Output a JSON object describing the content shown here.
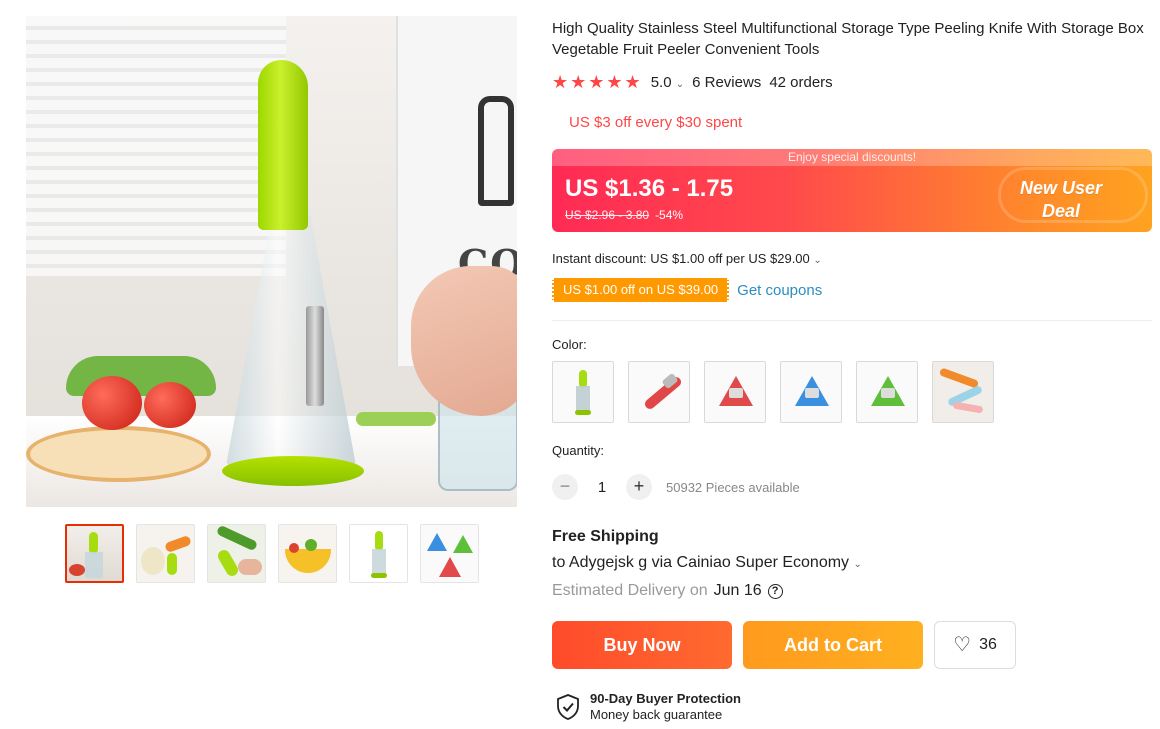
{
  "product": {
    "title": "High Quality Stainless Steel Multifunctional Storage Type Peeling Knife With Storage Box Vegetable Fruit Peeler Convenient Tools",
    "rating": {
      "stars": "★★★★★",
      "value": "5.0",
      "reviews": "6 Reviews",
      "orders": "42 orders"
    },
    "store_promo": "US $3 off every $30 spent"
  },
  "price_banner": {
    "top_text": "Enjoy special discounts!",
    "price": "US $1.36 - 1.75",
    "old_price": "US $2.96 - 3.80",
    "discount": "-54%",
    "deal_line1": "New User",
    "deal_line2": "Deal"
  },
  "discounts": {
    "instant": "Instant discount: US $1.00 off per US $29.00",
    "coupon": "US $1.00 off on US $39.00",
    "get_coupons": "Get coupons"
  },
  "options": {
    "color_label": "Color:",
    "swatches": [
      "green-peeler",
      "red-peeler",
      "red-triangle",
      "blue-triangle",
      "green-triangle",
      "multi-peelers"
    ],
    "quantity_label": "Quantity:",
    "minus": "−",
    "plus": "+",
    "quantity": "1",
    "available": "50932 Pieces available"
  },
  "shipping": {
    "title": "Free Shipping",
    "to": "to Adygejsk g via Cainiao Super Economy",
    "est_prefix": "Estimated Delivery on",
    "est_date": "Jun 16",
    "help": "?"
  },
  "actions": {
    "buy_now": "Buy Now",
    "add_to_cart": "Add to Cart",
    "wishlist_count": "36"
  },
  "protection": {
    "title": "90-Day Buyer Protection",
    "subtitle": "Money back guarantee"
  },
  "colors": {
    "accent": "#ff4747",
    "coupon": "#ff9900",
    "link": "#2a8ebd"
  }
}
